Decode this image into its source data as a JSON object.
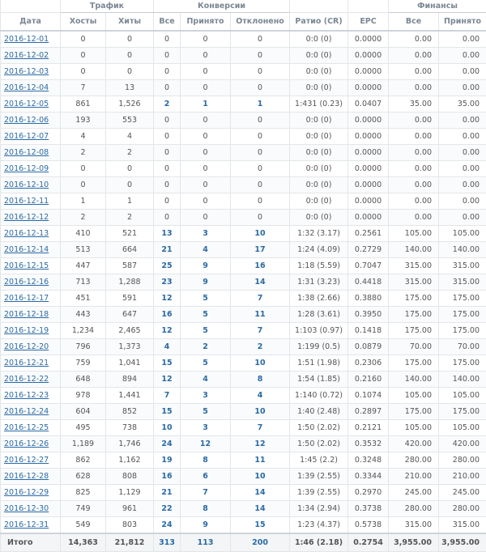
{
  "header": {
    "groups": {
      "traffic": "Трафик",
      "conversions": "Конверсии",
      "finance": "Финансы"
    },
    "columns": {
      "date": "Дата",
      "hosts": "Хосты",
      "hits": "Хиты",
      "conv_all": "Все",
      "conv_accepted": "Принято",
      "conv_rejected": "Отклонено",
      "ratio": "Ратио (CR)",
      "epc": "EPC",
      "fin_all": "Все",
      "fin_accepted": "Принято"
    }
  },
  "rows": [
    {
      "date": "2016-12-01",
      "hosts": "0",
      "hits": "0",
      "all": "0",
      "accepted": "0",
      "rejected": "0",
      "ratio": "0:0 (0)",
      "epc": "0.0000",
      "fin_all": "0.00",
      "fin_accepted": "0.00"
    },
    {
      "date": "2016-12-02",
      "hosts": "0",
      "hits": "0",
      "all": "0",
      "accepted": "0",
      "rejected": "0",
      "ratio": "0:0 (0)",
      "epc": "0.0000",
      "fin_all": "0.00",
      "fin_accepted": "0.00"
    },
    {
      "date": "2016-12-03",
      "hosts": "0",
      "hits": "0",
      "all": "0",
      "accepted": "0",
      "rejected": "0",
      "ratio": "0:0 (0)",
      "epc": "0.0000",
      "fin_all": "0.00",
      "fin_accepted": "0.00"
    },
    {
      "date": "2016-12-04",
      "hosts": "7",
      "hits": "13",
      "all": "0",
      "accepted": "0",
      "rejected": "0",
      "ratio": "0:0 (0)",
      "epc": "0.0000",
      "fin_all": "0.00",
      "fin_accepted": "0.00"
    },
    {
      "date": "2016-12-05",
      "hosts": "861",
      "hits": "1,526",
      "all": "2",
      "accepted": "1",
      "rejected": "1",
      "ratio": "1:431 (0.23)",
      "epc": "0.0407",
      "fin_all": "35.00",
      "fin_accepted": "35.00"
    },
    {
      "date": "2016-12-06",
      "hosts": "193",
      "hits": "553",
      "all": "0",
      "accepted": "0",
      "rejected": "0",
      "ratio": "0:0 (0)",
      "epc": "0.0000",
      "fin_all": "0.00",
      "fin_accepted": "0.00"
    },
    {
      "date": "2016-12-07",
      "hosts": "4",
      "hits": "4",
      "all": "0",
      "accepted": "0",
      "rejected": "0",
      "ratio": "0:0 (0)",
      "epc": "0.0000",
      "fin_all": "0.00",
      "fin_accepted": "0.00"
    },
    {
      "date": "2016-12-08",
      "hosts": "2",
      "hits": "2",
      "all": "0",
      "accepted": "0",
      "rejected": "0",
      "ratio": "0:0 (0)",
      "epc": "0.0000",
      "fin_all": "0.00",
      "fin_accepted": "0.00"
    },
    {
      "date": "2016-12-09",
      "hosts": "0",
      "hits": "0",
      "all": "0",
      "accepted": "0",
      "rejected": "0",
      "ratio": "0:0 (0)",
      "epc": "0.0000",
      "fin_all": "0.00",
      "fin_accepted": "0.00"
    },
    {
      "date": "2016-12-10",
      "hosts": "0",
      "hits": "0",
      "all": "0",
      "accepted": "0",
      "rejected": "0",
      "ratio": "0:0 (0)",
      "epc": "0.0000",
      "fin_all": "0.00",
      "fin_accepted": "0.00"
    },
    {
      "date": "2016-12-11",
      "hosts": "1",
      "hits": "1",
      "all": "0",
      "accepted": "0",
      "rejected": "0",
      "ratio": "0:0 (0)",
      "epc": "0.0000",
      "fin_all": "0.00",
      "fin_accepted": "0.00"
    },
    {
      "date": "2016-12-12",
      "hosts": "2",
      "hits": "2",
      "all": "0",
      "accepted": "0",
      "rejected": "0",
      "ratio": "0:0 (0)",
      "epc": "0.0000",
      "fin_all": "0.00",
      "fin_accepted": "0.00"
    },
    {
      "date": "2016-12-13",
      "hosts": "410",
      "hits": "521",
      "all": "13",
      "accepted": "3",
      "rejected": "10",
      "ratio": "1:32 (3.17)",
      "epc": "0.2561",
      "fin_all": "105.00",
      "fin_accepted": "105.00"
    },
    {
      "date": "2016-12-14",
      "hosts": "513",
      "hits": "664",
      "all": "21",
      "accepted": "4",
      "rejected": "17",
      "ratio": "1:24 (4.09)",
      "epc": "0.2729",
      "fin_all": "140.00",
      "fin_accepted": "140.00"
    },
    {
      "date": "2016-12-15",
      "hosts": "447",
      "hits": "587",
      "all": "25",
      "accepted": "9",
      "rejected": "16",
      "ratio": "1:18 (5.59)",
      "epc": "0.7047",
      "fin_all": "315.00",
      "fin_accepted": "315.00"
    },
    {
      "date": "2016-12-16",
      "hosts": "713",
      "hits": "1,288",
      "all": "23",
      "accepted": "9",
      "rejected": "14",
      "ratio": "1:31 (3.23)",
      "epc": "0.4418",
      "fin_all": "315.00",
      "fin_accepted": "315.00"
    },
    {
      "date": "2016-12-17",
      "hosts": "451",
      "hits": "591",
      "all": "12",
      "accepted": "5",
      "rejected": "7",
      "ratio": "1:38 (2.66)",
      "epc": "0.3880",
      "fin_all": "175.00",
      "fin_accepted": "175.00"
    },
    {
      "date": "2016-12-18",
      "hosts": "443",
      "hits": "647",
      "all": "16",
      "accepted": "5",
      "rejected": "11",
      "ratio": "1:28 (3.61)",
      "epc": "0.3950",
      "fin_all": "175.00",
      "fin_accepted": "175.00"
    },
    {
      "date": "2016-12-19",
      "hosts": "1,234",
      "hits": "2,465",
      "all": "12",
      "accepted": "5",
      "rejected": "7",
      "ratio": "1:103 (0.97)",
      "epc": "0.1418",
      "fin_all": "175.00",
      "fin_accepted": "175.00"
    },
    {
      "date": "2016-12-20",
      "hosts": "796",
      "hits": "1,373",
      "all": "4",
      "accepted": "2",
      "rejected": "2",
      "ratio": "1:199 (0.5)",
      "epc": "0.0879",
      "fin_all": "70.00",
      "fin_accepted": "70.00"
    },
    {
      "date": "2016-12-21",
      "hosts": "759",
      "hits": "1,041",
      "all": "15",
      "accepted": "5",
      "rejected": "10",
      "ratio": "1:51 (1.98)",
      "epc": "0.2306",
      "fin_all": "175.00",
      "fin_accepted": "175.00"
    },
    {
      "date": "2016-12-22",
      "hosts": "648",
      "hits": "894",
      "all": "12",
      "accepted": "4",
      "rejected": "8",
      "ratio": "1:54 (1.85)",
      "epc": "0.2160",
      "fin_all": "140.00",
      "fin_accepted": "140.00"
    },
    {
      "date": "2016-12-23",
      "hosts": "978",
      "hits": "1,441",
      "all": "7",
      "accepted": "3",
      "rejected": "4",
      "ratio": "1:140 (0.72)",
      "epc": "0.1074",
      "fin_all": "105.00",
      "fin_accepted": "105.00"
    },
    {
      "date": "2016-12-24",
      "hosts": "604",
      "hits": "852",
      "all": "15",
      "accepted": "5",
      "rejected": "10",
      "ratio": "1:40 (2.48)",
      "epc": "0.2897",
      "fin_all": "175.00",
      "fin_accepted": "175.00"
    },
    {
      "date": "2016-12-25",
      "hosts": "495",
      "hits": "738",
      "all": "10",
      "accepted": "3",
      "rejected": "7",
      "ratio": "1:50 (2.02)",
      "epc": "0.2121",
      "fin_all": "105.00",
      "fin_accepted": "105.00"
    },
    {
      "date": "2016-12-26",
      "hosts": "1,189",
      "hits": "1,746",
      "all": "24",
      "accepted": "12",
      "rejected": "12",
      "ratio": "1:50 (2.02)",
      "epc": "0.3532",
      "fin_all": "420.00",
      "fin_accepted": "420.00"
    },
    {
      "date": "2016-12-27",
      "hosts": "862",
      "hits": "1,162",
      "all": "19",
      "accepted": "8",
      "rejected": "11",
      "ratio": "1:45 (2.2)",
      "epc": "0.3248",
      "fin_all": "280.00",
      "fin_accepted": "280.00"
    },
    {
      "date": "2016-12-28",
      "hosts": "628",
      "hits": "808",
      "all": "16",
      "accepted": "6",
      "rejected": "10",
      "ratio": "1:39 (2.55)",
      "epc": "0.3344",
      "fin_all": "210.00",
      "fin_accepted": "210.00"
    },
    {
      "date": "2016-12-29",
      "hosts": "825",
      "hits": "1,129",
      "all": "21",
      "accepted": "7",
      "rejected": "14",
      "ratio": "1:39 (2.55)",
      "epc": "0.2970",
      "fin_all": "245.00",
      "fin_accepted": "245.00"
    },
    {
      "date": "2016-12-30",
      "hosts": "749",
      "hits": "961",
      "all": "22",
      "accepted": "8",
      "rejected": "14",
      "ratio": "1:34 (2.94)",
      "epc": "0.3738",
      "fin_all": "280.00",
      "fin_accepted": "280.00"
    },
    {
      "date": "2016-12-31",
      "hosts": "549",
      "hits": "803",
      "all": "24",
      "accepted": "9",
      "rejected": "15",
      "ratio": "1:23 (4.37)",
      "epc": "0.5738",
      "fin_all": "315.00",
      "fin_accepted": "315.00"
    }
  ],
  "totals": {
    "label": "Итого",
    "hosts": "14,363",
    "hits": "21,812",
    "all": "313",
    "accepted": "113",
    "rejected": "200",
    "ratio": "1:46 (2.18)",
    "epc": "0.2754",
    "fin_all": "3,955.00",
    "fin_accepted": "3,955.00"
  },
  "style": {
    "link_color": "#2a6aa5",
    "border_color": "#e3e6ea",
    "header_text": "#7b8794"
  }
}
